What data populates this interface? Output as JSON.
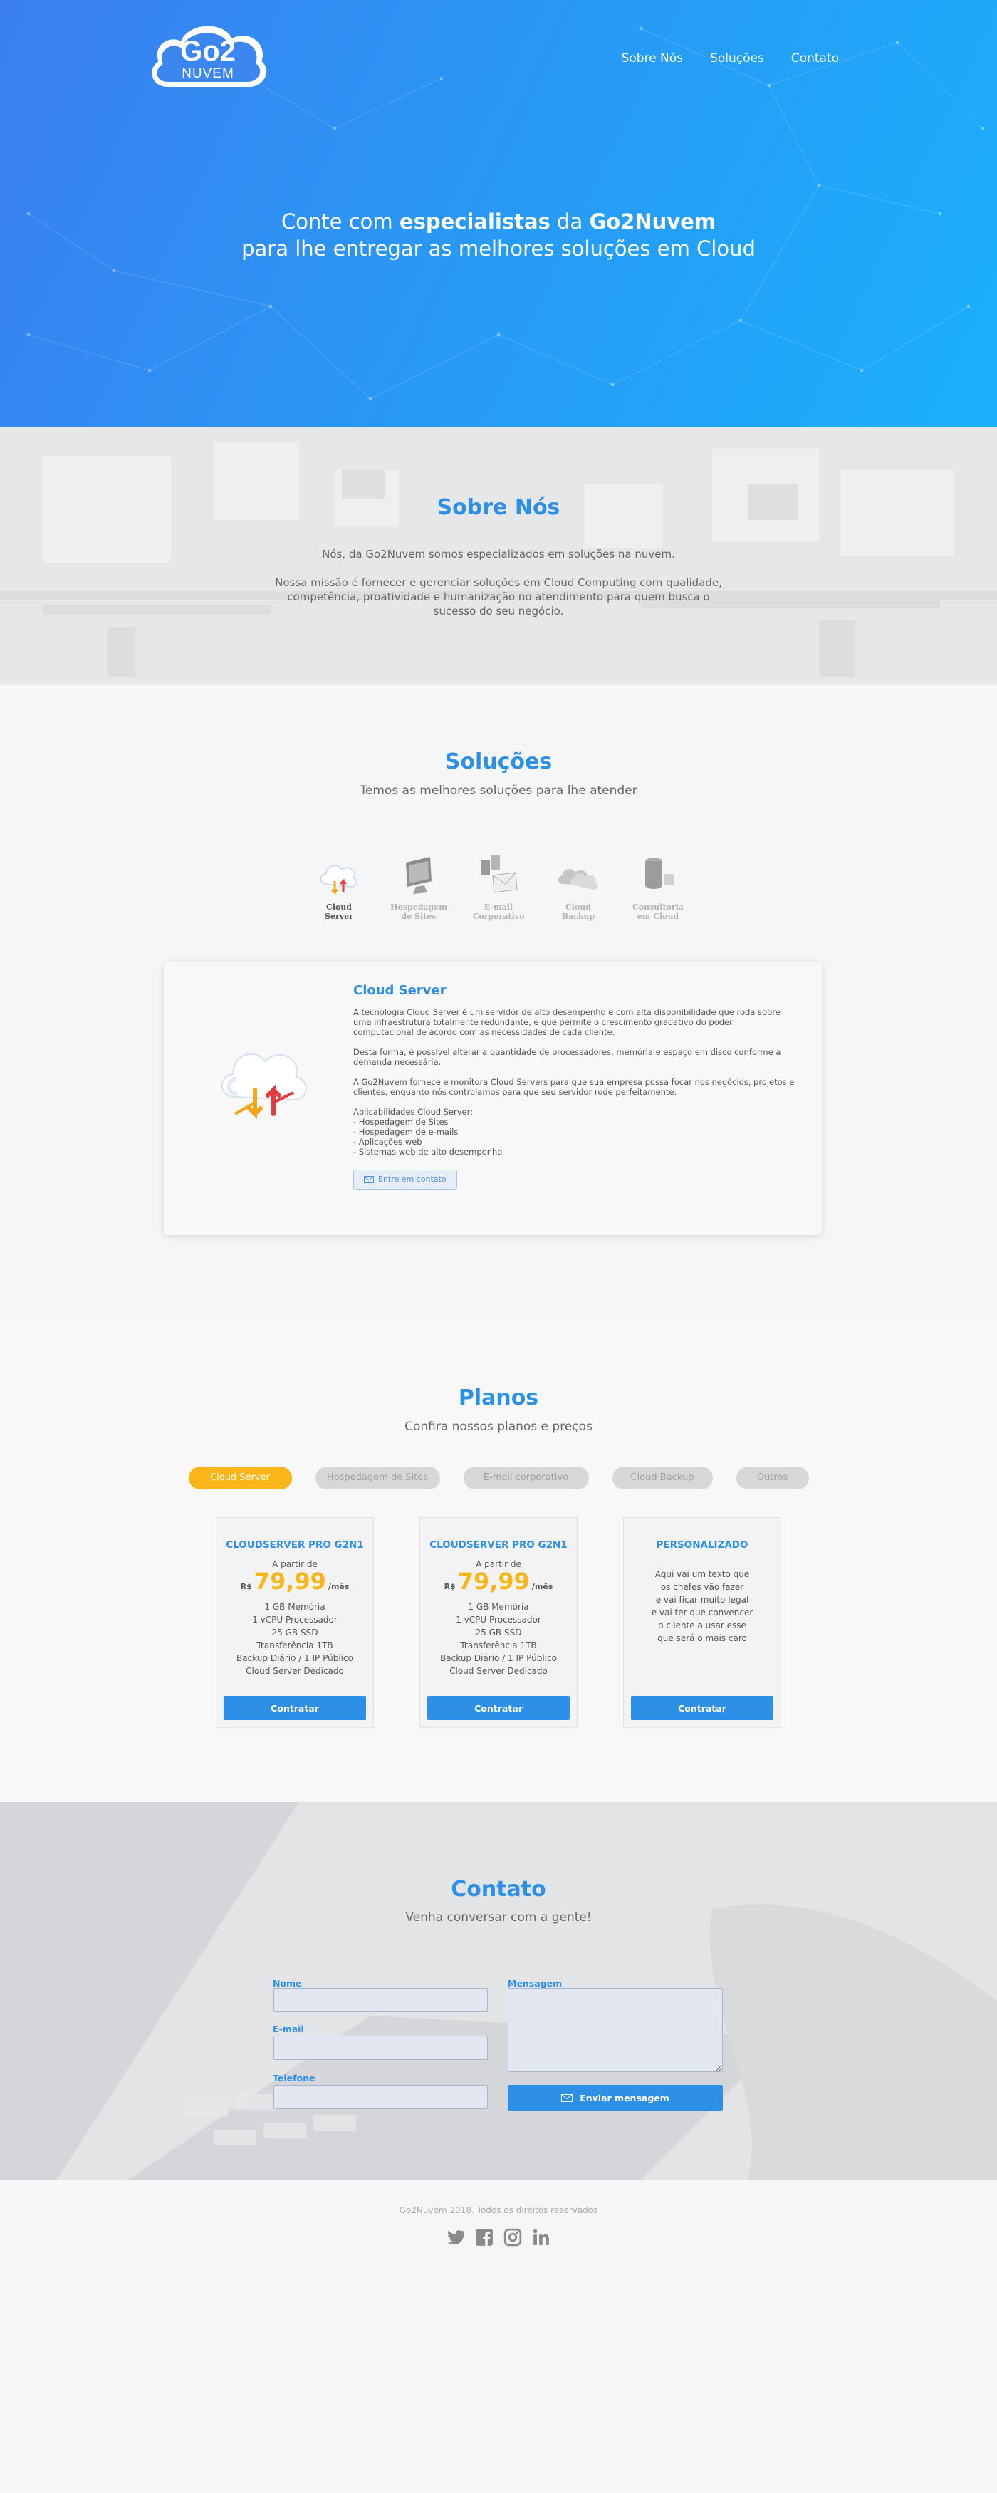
{
  "brand": {
    "logo_top": "Go2",
    "logo_bottom": "NUVEM"
  },
  "nav": [
    {
      "label": "Sobre Nós"
    },
    {
      "label": "Soluções"
    },
    {
      "label": "Contato"
    }
  ],
  "hero": {
    "line1_pre": "Conte com ",
    "line1_bold1": "especialistas",
    "line1_mid": " da ",
    "line1_bold2": "Go2Nuvem",
    "line2": "para lhe entregar as melhores soluções em Cloud"
  },
  "sobre": {
    "title": "Sobre Nós",
    "p1": "Nós, da Go2Nuvem somos especializados em soluções na nuvem.",
    "p2": "Nossa missão é fornecer e gerenciar soluções em Cloud Computing com qualidade, competência, proatividade e humanização no atendimento para quem busca o sucesso do seu negócio."
  },
  "solucoes": {
    "title": "Soluções",
    "subtitle": "Temos as melhores soluções para lhe atender",
    "items": [
      {
        "line1": "Cloud",
        "line2": "Server",
        "icon": "cloud-server-icon"
      },
      {
        "line1": "Hospedagem",
        "line2": "de Sites",
        "icon": "monitor-icon"
      },
      {
        "line1": "E-mail",
        "line2": "Corporativo",
        "icon": "email-icon"
      },
      {
        "line1": "Cloud",
        "line2": "Backup",
        "icon": "cloud-backup-icon"
      },
      {
        "line1": "Consultoria",
        "line2": "em Cloud",
        "icon": "database-icon"
      }
    ],
    "card": {
      "title": "Cloud Server",
      "p1": "A tecnologia Cloud Server é um servidor de alto desempenho e com alta disponibilidade que roda sobre uma infraestrutura totalmente redundante, e que permite o crescimento gradativo do poder computacional de acordo com as necessidades de cada cliente.",
      "p2": "Desta forma, é possível alterar a quantidade de processadores, memória e espaço em disco conforme a demanda necessária.",
      "p3": "A Go2Nuvem fornece e monitora Cloud Servers para que sua empresa possa focar nos negócios, projetos e clientes, enquanto nós controlamos para que seu servidor rode perfeitamente.",
      "p4": "Aplicabilidades Cloud Server:\n- Hospedagem de Sites\n- Hospedagem de e-mails\n- Aplicações web\n- Sistemas web de alto desempenho",
      "button": "Entre em contato"
    }
  },
  "planos": {
    "title": "Planos",
    "subtitle": "Confira nossos planos e preços",
    "tabs": [
      "Cloud Server",
      "Hospedagem de Sites",
      "E-mail corporativo",
      "Cloud Backup",
      "Outros"
    ],
    "cards": [
      {
        "title": "CLOUDSERVER PRO G2N1",
        "from": "A partir de",
        "currency": "R$",
        "price": "79,99",
        "period": "/mês",
        "features": [
          "1 GB Memória",
          "1 vCPU Processador",
          "25 GB SSD",
          "Transferência 1TB",
          "Backup Diário / 1 IP Público",
          "Cloud Server  Dedicado"
        ],
        "button": "Contratar"
      },
      {
        "title": "CLOUDSERVER PRO G2N1",
        "from": "A partir de",
        "currency": "R$",
        "price": "79,99",
        "period": "/mês",
        "features": [
          "1 GB Memória",
          "1 vCPU Processador",
          "25 GB SSD",
          "Transferência 1TB",
          "Backup Diário / 1 IP Público",
          "Cloud Server  Dedicado"
        ],
        "button": "Contratar"
      },
      {
        "title": "PERSONALIZADO",
        "desc": "Aqui vai um texto que\nos chefes vão fazer\ne vai ficar muito legal\ne vai ter que convencer\no cliente a usar esse\nque será o mais caro",
        "button": "Contratar"
      }
    ]
  },
  "contato": {
    "title": "Contato",
    "subtitle": "Venha conversar com a gente!",
    "labels": {
      "nome": "Nome",
      "email": "E-mail",
      "telefone": "Telefone",
      "mensagem": "Mensagem"
    },
    "button": "Enviar mensagem"
  },
  "footer": {
    "copyright": "Go2Nuvem 2018. Todos os direitos reservados",
    "socials": [
      "twitter-icon",
      "facebook-icon",
      "instagram-icon",
      "linkedin-icon"
    ]
  },
  "colors": {
    "primary": "#2e8fe6",
    "accent": "#fab619",
    "hero_start": "#3b7ef0",
    "hero_end": "#1ab0fa"
  }
}
